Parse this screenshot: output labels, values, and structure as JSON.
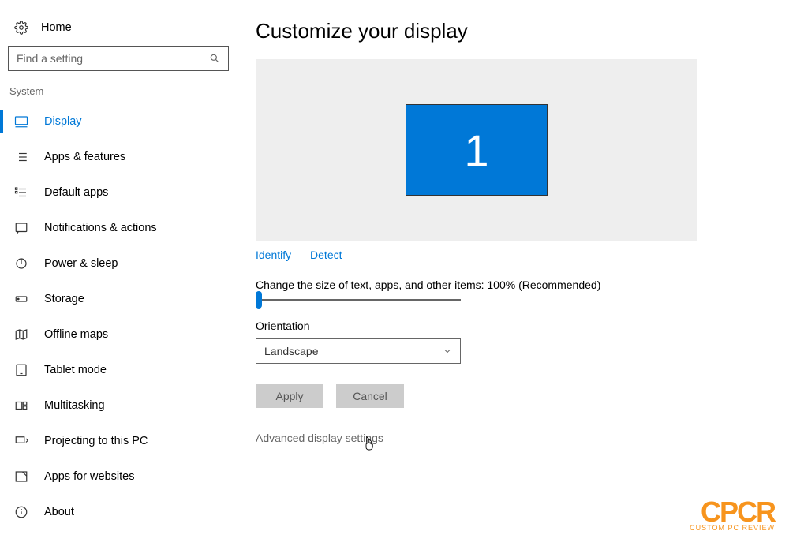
{
  "home_label": "Home",
  "search": {
    "placeholder": "Find a setting"
  },
  "section_label": "System",
  "nav": [
    {
      "key": "display",
      "label": "Display",
      "active": true
    },
    {
      "key": "apps-features",
      "label": "Apps & features"
    },
    {
      "key": "default-apps",
      "label": "Default apps"
    },
    {
      "key": "notifications",
      "label": "Notifications & actions"
    },
    {
      "key": "power-sleep",
      "label": "Power & sleep"
    },
    {
      "key": "storage",
      "label": "Storage"
    },
    {
      "key": "offline-maps",
      "label": "Offline maps"
    },
    {
      "key": "tablet-mode",
      "label": "Tablet mode"
    },
    {
      "key": "multitasking",
      "label": "Multitasking"
    },
    {
      "key": "projecting",
      "label": "Projecting to this PC"
    },
    {
      "key": "apps-websites",
      "label": "Apps for websites"
    },
    {
      "key": "about",
      "label": "About"
    }
  ],
  "page_title": "Customize your display",
  "monitor_number": "1",
  "links": {
    "identify": "Identify",
    "detect": "Detect"
  },
  "scale_label": "Change the size of text, apps, and other items: 100% (Recommended)",
  "orientation": {
    "label": "Orientation",
    "value": "Landscape"
  },
  "buttons": {
    "apply": "Apply",
    "cancel": "Cancel"
  },
  "advanced_link": "Advanced display settings",
  "watermark": {
    "big": "CPCR",
    "small": "CUSTOM PC REVIEW"
  }
}
